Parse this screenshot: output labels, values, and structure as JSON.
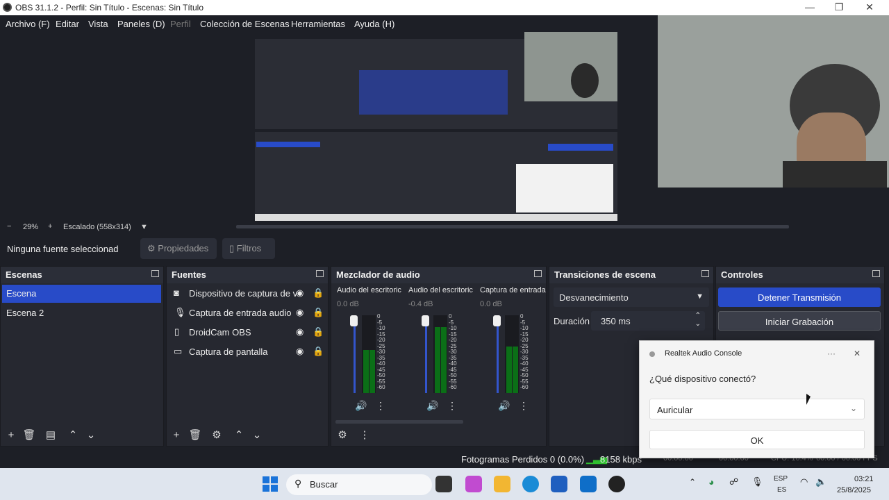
{
  "window": {
    "title": "OBS 31.1.2 - Perfil: Sin Título - Escenas: Sin Título",
    "minimize": "—",
    "maximize": "❐",
    "close": "✕"
  },
  "menu": [
    "Archivo (F)",
    "Editar",
    "Vista",
    "Paneles (D)",
    "Perfil",
    "Colección de Escenas",
    "Herramientas",
    "Ayuda (H)"
  ],
  "zoom": {
    "minus": "−",
    "value": "29%",
    "plus": "+",
    "scale": "Escalado (558x314)",
    "arrow": "▼"
  },
  "source_toolbar": {
    "no_source": "Ninguna fuente seleccionad",
    "properties": "Propiedades",
    "filters": "Filtros"
  },
  "scenes": {
    "title": "Escenas",
    "items": [
      "Escena",
      "Escena 2"
    ]
  },
  "sources": {
    "title": "Fuentes",
    "items": [
      "Dispositivo de captura de v",
      "Captura de entrada audio",
      "DroidCam OBS",
      "Captura de pantalla"
    ]
  },
  "mixer": {
    "title": "Mezclador de audio",
    "channels": [
      {
        "name": "Audio del escritoric",
        "db": "0.0 dB",
        "level": 0.55
      },
      {
        "name": "Audio del escritoric",
        "db": "-0.4 dB",
        "level": 0.85
      },
      {
        "name": "Captura de entrada",
        "db": "0.0 dB",
        "level": 0.6
      }
    ],
    "scale": [
      "0",
      "-5",
      "-10",
      "-15",
      "-20",
      "-25",
      "-30",
      "-35",
      "-40",
      "-45",
      "-50",
      "-55",
      "-60"
    ]
  },
  "transitions": {
    "title": "Transiciones de escena",
    "selected": "Desvanecimiento",
    "duration_label": "Duración",
    "duration_value": "350 ms"
  },
  "controls": {
    "title": "Controles",
    "stop_stream": "Detener Transmisión",
    "start_record": "Iniciar Grabación"
  },
  "status": {
    "dropped": "Fotogramas Perdidos 0 (0.0%)",
    "bitrate": "8158 kbps",
    "t1": "00:00:00",
    "t2": "00:00:00",
    "cpu": "CPU: 10.4%",
    "fps": "60.00 / 60.00 FPS"
  },
  "dialog": {
    "title": "Realtek Audio Console",
    "more": "···",
    "close": "✕",
    "question": "¿Qué dispositivo conectó?",
    "selected": "Auricular",
    "ok": "OK"
  },
  "taskbar": {
    "search": "Buscar",
    "lang1": "ESP",
    "lang2": "ES",
    "time": "03:21",
    "date": "25/8/2025"
  },
  "colors": {
    "accent": "#284bc8",
    "panel": "#262830",
    "background": "#1d1f26",
    "meter_green": "#0b6f17"
  }
}
